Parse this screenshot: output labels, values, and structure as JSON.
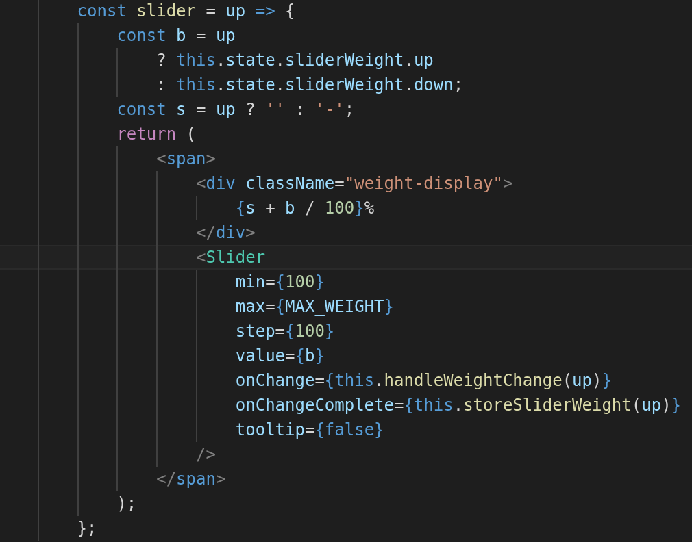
{
  "editor": {
    "lines": [
      {
        "current": false,
        "tokens": [
          {
            "kind": "keyword",
            "text": "        const"
          },
          {
            "kind": "function",
            "text": " slider"
          },
          {
            "kind": "plain",
            "text": " = "
          },
          {
            "kind": "variable",
            "text": "up"
          },
          {
            "kind": "keyword",
            "text": " =>"
          },
          {
            "kind": "plain",
            "text": " {"
          }
        ]
      },
      {
        "current": false,
        "tokens": [
          {
            "kind": "keyword",
            "text": "            const"
          },
          {
            "kind": "variable",
            "text": " b"
          },
          {
            "kind": "plain",
            "text": " = "
          },
          {
            "kind": "variable",
            "text": "up"
          }
        ]
      },
      {
        "current": false,
        "tokens": [
          {
            "kind": "plain",
            "text": "                ? "
          },
          {
            "kind": "keyword",
            "text": "this"
          },
          {
            "kind": "plain",
            "text": "."
          },
          {
            "kind": "variable",
            "text": "state"
          },
          {
            "kind": "plain",
            "text": "."
          },
          {
            "kind": "variable",
            "text": "sliderWeight"
          },
          {
            "kind": "plain",
            "text": "."
          },
          {
            "kind": "variable",
            "text": "up"
          }
        ]
      },
      {
        "current": false,
        "tokens": [
          {
            "kind": "plain",
            "text": "                : "
          },
          {
            "kind": "keyword",
            "text": "this"
          },
          {
            "kind": "plain",
            "text": "."
          },
          {
            "kind": "variable",
            "text": "state"
          },
          {
            "kind": "plain",
            "text": "."
          },
          {
            "kind": "variable",
            "text": "sliderWeight"
          },
          {
            "kind": "plain",
            "text": "."
          },
          {
            "kind": "variable",
            "text": "down"
          },
          {
            "kind": "plain",
            "text": ";"
          }
        ]
      },
      {
        "current": false,
        "tokens": [
          {
            "kind": "keyword",
            "text": "            const"
          },
          {
            "kind": "variable",
            "text": " s"
          },
          {
            "kind": "plain",
            "text": " = "
          },
          {
            "kind": "variable",
            "text": "up"
          },
          {
            "kind": "plain",
            "text": " ? "
          },
          {
            "kind": "string",
            "text": "''"
          },
          {
            "kind": "plain",
            "text": " : "
          },
          {
            "kind": "string",
            "text": "'-'"
          },
          {
            "kind": "plain",
            "text": ";"
          }
        ]
      },
      {
        "current": false,
        "tokens": [
          {
            "kind": "control",
            "text": "            return"
          },
          {
            "kind": "plain",
            "text": " ("
          }
        ]
      },
      {
        "current": false,
        "tokens": [
          {
            "kind": "bracket",
            "text": "                <"
          },
          {
            "kind": "tag",
            "text": "span"
          },
          {
            "kind": "bracket",
            "text": ">"
          }
        ]
      },
      {
        "current": false,
        "tokens": [
          {
            "kind": "bracket",
            "text": "                    <"
          },
          {
            "kind": "tag",
            "text": "div"
          },
          {
            "kind": "attribute",
            "text": " className"
          },
          {
            "kind": "plain",
            "text": "="
          },
          {
            "kind": "string",
            "text": "\"weight-display\""
          },
          {
            "kind": "bracket",
            "text": ">"
          }
        ]
      },
      {
        "current": false,
        "tokens": [
          {
            "kind": "keyword",
            "text": "                        {"
          },
          {
            "kind": "variable",
            "text": "s"
          },
          {
            "kind": "plain",
            "text": " + "
          },
          {
            "kind": "variable",
            "text": "b"
          },
          {
            "kind": "plain",
            "text": " / "
          },
          {
            "kind": "number",
            "text": "100"
          },
          {
            "kind": "keyword",
            "text": "}"
          },
          {
            "kind": "plain",
            "text": "%"
          }
        ]
      },
      {
        "current": false,
        "tokens": [
          {
            "kind": "bracket",
            "text": "                    </"
          },
          {
            "kind": "tag",
            "text": "div"
          },
          {
            "kind": "bracket",
            "text": ">"
          }
        ]
      },
      {
        "current": true,
        "tokens": [
          {
            "kind": "bracket",
            "text": "                    <"
          },
          {
            "kind": "component",
            "text": "Slider"
          }
        ]
      },
      {
        "current": false,
        "tokens": [
          {
            "kind": "attribute",
            "text": "                        min"
          },
          {
            "kind": "plain",
            "text": "="
          },
          {
            "kind": "keyword",
            "text": "{"
          },
          {
            "kind": "number",
            "text": "100"
          },
          {
            "kind": "keyword",
            "text": "}"
          }
        ]
      },
      {
        "current": false,
        "tokens": [
          {
            "kind": "attribute",
            "text": "                        max"
          },
          {
            "kind": "plain",
            "text": "="
          },
          {
            "kind": "keyword",
            "text": "{"
          },
          {
            "kind": "variable",
            "text": "MAX_WEIGHT"
          },
          {
            "kind": "keyword",
            "text": "}"
          }
        ]
      },
      {
        "current": false,
        "tokens": [
          {
            "kind": "attribute",
            "text": "                        step"
          },
          {
            "kind": "plain",
            "text": "="
          },
          {
            "kind": "keyword",
            "text": "{"
          },
          {
            "kind": "number",
            "text": "100"
          },
          {
            "kind": "keyword",
            "text": "}"
          }
        ]
      },
      {
        "current": false,
        "tokens": [
          {
            "kind": "attribute",
            "text": "                        value"
          },
          {
            "kind": "plain",
            "text": "="
          },
          {
            "kind": "keyword",
            "text": "{"
          },
          {
            "kind": "variable",
            "text": "b"
          },
          {
            "kind": "keyword",
            "text": "}"
          }
        ]
      },
      {
        "current": false,
        "tokens": [
          {
            "kind": "attribute",
            "text": "                        onChange"
          },
          {
            "kind": "plain",
            "text": "="
          },
          {
            "kind": "keyword",
            "text": "{this"
          },
          {
            "kind": "plain",
            "text": "."
          },
          {
            "kind": "function",
            "text": "handleWeightChange"
          },
          {
            "kind": "plain",
            "text": "("
          },
          {
            "kind": "variable",
            "text": "up"
          },
          {
            "kind": "plain",
            "text": ")"
          },
          {
            "kind": "keyword",
            "text": "}"
          }
        ]
      },
      {
        "current": false,
        "tokens": [
          {
            "kind": "attribute",
            "text": "                        onChangeComplete"
          },
          {
            "kind": "plain",
            "text": "="
          },
          {
            "kind": "keyword",
            "text": "{this"
          },
          {
            "kind": "plain",
            "text": "."
          },
          {
            "kind": "function",
            "text": "storeSliderWeight"
          },
          {
            "kind": "plain",
            "text": "("
          },
          {
            "kind": "variable",
            "text": "up"
          },
          {
            "kind": "plain",
            "text": ")"
          },
          {
            "kind": "keyword",
            "text": "}"
          }
        ]
      },
      {
        "current": false,
        "tokens": [
          {
            "kind": "attribute",
            "text": "                        tooltip"
          },
          {
            "kind": "plain",
            "text": "="
          },
          {
            "kind": "keyword",
            "text": "{false}"
          }
        ]
      },
      {
        "current": false,
        "tokens": [
          {
            "kind": "bracket",
            "text": "                    />"
          }
        ]
      },
      {
        "current": false,
        "tokens": [
          {
            "kind": "bracket",
            "text": "                </"
          },
          {
            "kind": "tag",
            "text": "span"
          },
          {
            "kind": "bracket",
            "text": ">"
          }
        ]
      },
      {
        "current": false,
        "tokens": [
          {
            "kind": "plain",
            "text": "            );"
          }
        ]
      },
      {
        "current": false,
        "tokens": [
          {
            "kind": "plain",
            "text": "        };"
          }
        ]
      }
    ]
  }
}
